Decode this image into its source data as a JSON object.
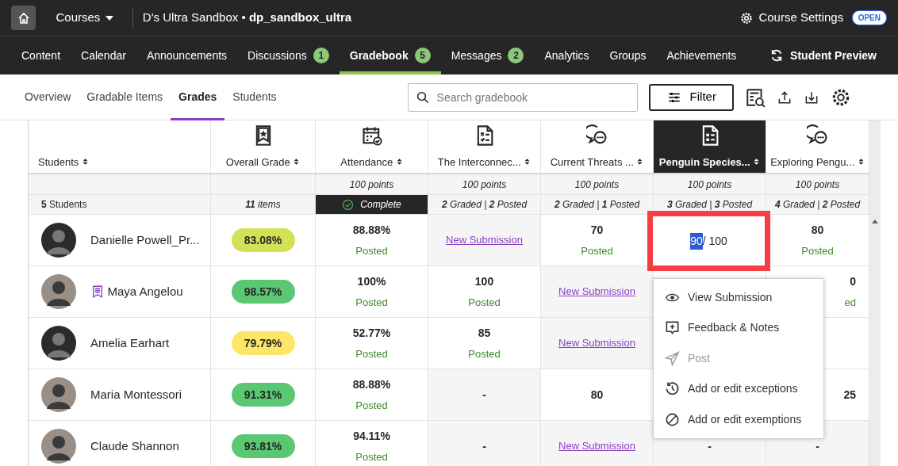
{
  "topbar": {
    "courses": "Courses",
    "course_title": "D's Ultra Sandbox • **dp_sandbox_ultra**",
    "settings": "Course Settings",
    "status_badge": "OPEN"
  },
  "nav": [
    {
      "label": "Content",
      "selected": false
    },
    {
      "label": "Calendar",
      "selected": false
    },
    {
      "label": "Announcements",
      "selected": false
    },
    {
      "label": "Discussions",
      "badge": "1",
      "selected": false
    },
    {
      "label": "Gradebook",
      "badge": "5",
      "selected": true
    },
    {
      "label": "Messages",
      "badge": "2",
      "selected": false
    },
    {
      "label": "Analytics",
      "selected": false
    },
    {
      "label": "Groups",
      "selected": false
    },
    {
      "label": "Achievements",
      "selected": false
    }
  ],
  "student_preview": "Student Preview",
  "subtabs": [
    {
      "label": "Overview",
      "selected": false
    },
    {
      "label": "Gradable Items",
      "selected": false
    },
    {
      "label": "Grades",
      "selected": true
    },
    {
      "label": "Students",
      "selected": false
    }
  ],
  "search": {
    "placeholder": "Search gradebook"
  },
  "filter": "Filter",
  "columns": [
    {
      "label": "Students",
      "kind": "students",
      "selected": false
    },
    {
      "label": "Overall Grade",
      "kind": "overall",
      "selected": false
    },
    {
      "label": "Attendance",
      "kind": "attendance",
      "selected": false,
      "points": "100 points"
    },
    {
      "label": "The Interconnec...",
      "kind": "test",
      "selected": false,
      "points": "100 points"
    },
    {
      "label": "Current Threats ...",
      "kind": "discussion",
      "selected": false,
      "points": "100 points"
    },
    {
      "label": "Penguin Species...",
      "kind": "assignment",
      "selected": true,
      "points": "100 points"
    },
    {
      "label": "Exploring Pengu...",
      "kind": "discussion",
      "selected": false,
      "points": "100 points"
    }
  ],
  "summary": [
    {
      "kind": "count",
      "text": "**5** Students"
    },
    {
      "kind": "items",
      "text": "**11** items"
    },
    {
      "kind": "complete",
      "text": "Complete"
    },
    {
      "kind": "stats",
      "text": "**2** Graded | **2** Posted"
    },
    {
      "kind": "stats",
      "text": "**2** Graded | **1** Posted"
    },
    {
      "kind": "stats",
      "text": "**3** Graded | **3** Posted"
    },
    {
      "kind": "stats",
      "text": "**4** Graded | **2** Posted"
    }
  ],
  "rows": [
    {
      "name": "Danielle Powell_Pr...",
      "kind": "default",
      "accommodation": false,
      "overall": "83.08%",
      "color": "#d4e157",
      "cells": [
        {
          "kind": "grade",
          "value": "88.88%",
          "status": "Posted"
        },
        {
          "kind": "new",
          "text": "New Submission"
        },
        {
          "kind": "grade",
          "value": "70",
          "status": "Posted"
        },
        {
          "kind": "editing",
          "selected_text": "90",
          "rest": " / 100"
        },
        {
          "kind": "grade",
          "value": "80",
          "status": "Posted"
        }
      ]
    },
    {
      "name": "Maya Angelou",
      "kind": "photo",
      "accommodation": true,
      "overall": "98.57%",
      "color": "#5ac773",
      "cells": [
        {
          "kind": "grade",
          "value": "100%",
          "status": "Posted"
        },
        {
          "kind": "grade",
          "value": "100",
          "status": "Posted"
        },
        {
          "kind": "new",
          "text": "New Submission"
        },
        {
          "kind": "hidden"
        },
        {
          "kind": "partial",
          "value": "0",
          "status": "ed"
        }
      ]
    },
    {
      "name": "Amelia Earhart",
      "kind": "default",
      "accommodation": false,
      "overall": "79.79%",
      "color": "#fde567",
      "cells": [
        {
          "kind": "grade",
          "value": "52.77%",
          "status": "Posted"
        },
        {
          "kind": "grade",
          "value": "85",
          "status": "Posted"
        },
        {
          "kind": "new",
          "text": "New Submission"
        },
        {
          "kind": "hidden"
        },
        {
          "kind": "hidden"
        }
      ]
    },
    {
      "name": "Maria Montessori",
      "kind": "photo",
      "accommodation": false,
      "overall": "91.31%",
      "color": "#5ac773",
      "cells": [
        {
          "kind": "grade",
          "value": "88.88%",
          "status": "Posted"
        },
        {
          "kind": "dash",
          "text": "-"
        },
        {
          "kind": "value",
          "value": "80"
        },
        {
          "kind": "hidden"
        },
        {
          "kind": "partial",
          "value": "25"
        }
      ]
    },
    {
      "name": "Claude Shannon",
      "kind": "photo",
      "accommodation": false,
      "overall": "93.81%",
      "color": "#5ac773",
      "cells": [
        {
          "kind": "grade",
          "value": "94.11%",
          "status": "Posted"
        },
        {
          "kind": "dash",
          "text": "-"
        },
        {
          "kind": "new",
          "text": "New Submission"
        },
        {
          "kind": "dash",
          "text": "-"
        },
        {
          "kind": "dash",
          "text": "-"
        }
      ]
    }
  ],
  "menu": [
    {
      "label": "View Submission",
      "disabled": false
    },
    {
      "label": "Feedback & Notes",
      "disabled": false
    },
    {
      "label": "Post",
      "disabled": true
    },
    {
      "label": "Add or edit exceptions",
      "disabled": false
    },
    {
      "label": "Add or edit exemptions",
      "disabled": false
    }
  ]
}
